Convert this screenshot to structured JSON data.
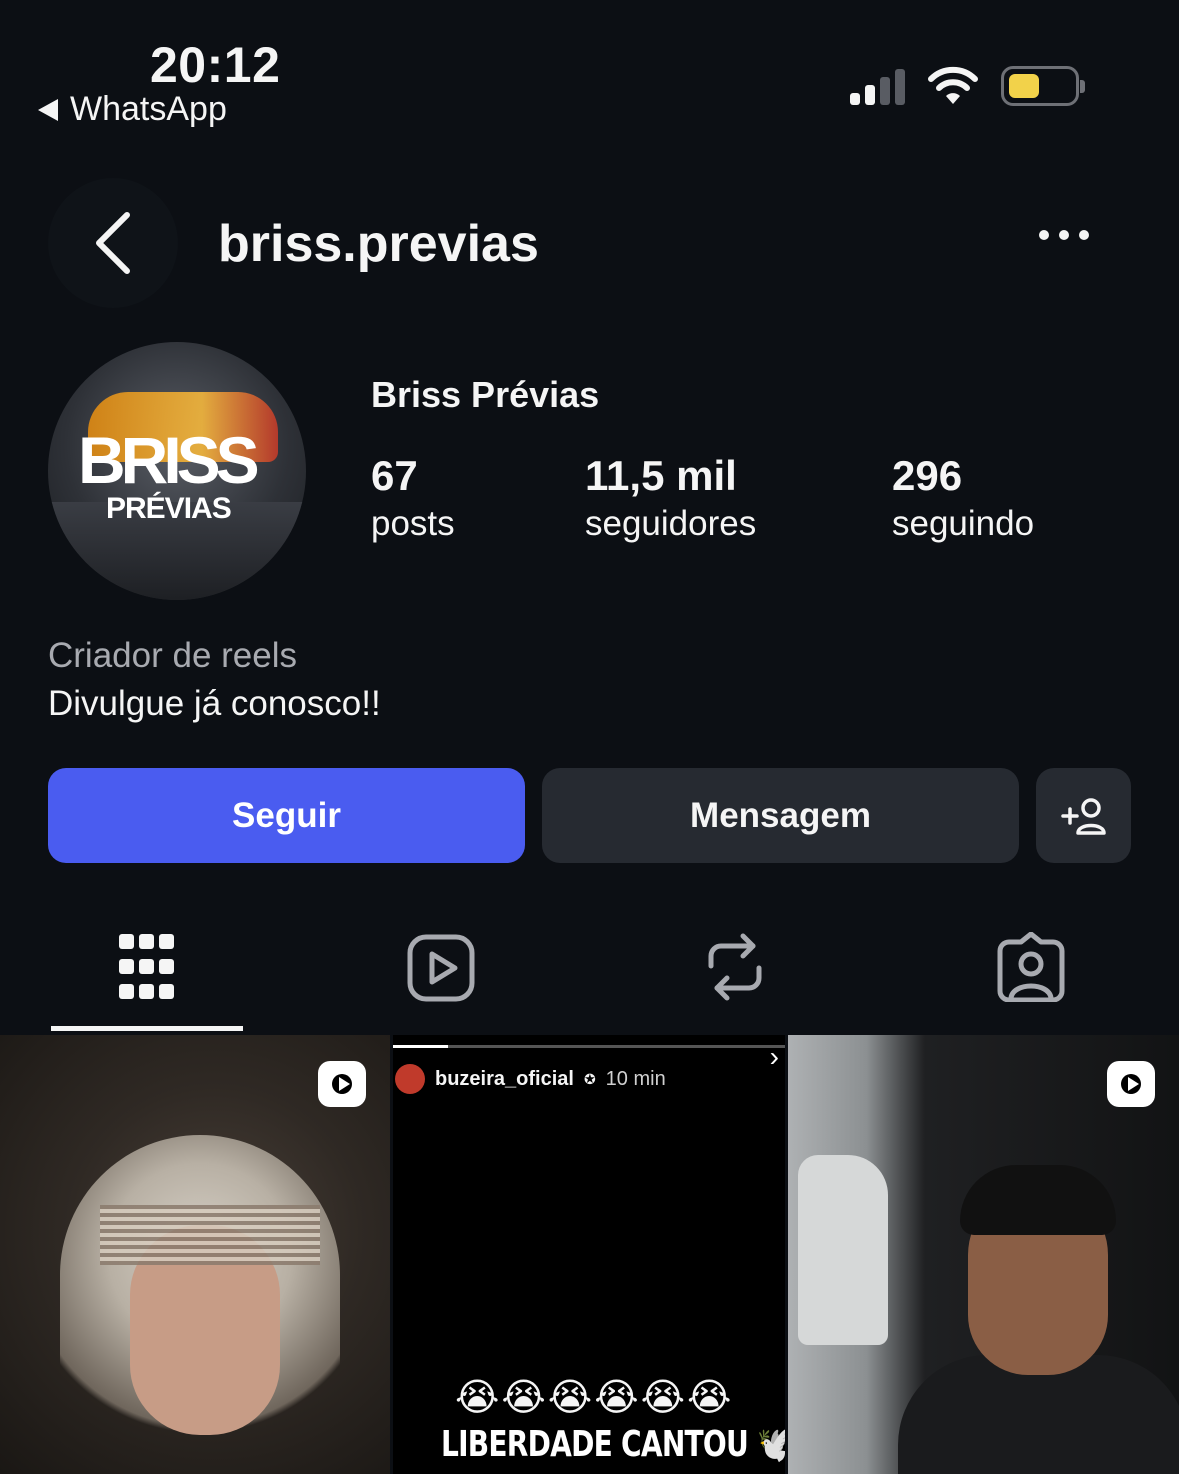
{
  "status_bar": {
    "time": "20:12",
    "back_app": "WhatsApp"
  },
  "header": {
    "username": "briss.previas"
  },
  "profile": {
    "avatar_text_main": "BRISS",
    "avatar_text_sub": "PRÉVIAS",
    "display_name": "Briss Prévias",
    "stats": [
      {
        "value": "67",
        "label": "posts"
      },
      {
        "value": "11,5 mil",
        "label": "seguidores"
      },
      {
        "value": "296",
        "label": "seguindo"
      }
    ],
    "category": "Criador de reels",
    "bio": "Divulgue já conosco!!"
  },
  "actions": {
    "follow": "Seguir",
    "message": "Mensagem"
  },
  "tabs": [
    {
      "icon": "grid-icon",
      "active": true
    },
    {
      "icon": "reels-icon",
      "active": false
    },
    {
      "icon": "repost-icon",
      "active": false
    },
    {
      "icon": "tagged-icon",
      "active": false
    }
  ],
  "grid": {
    "post2": {
      "story_user": "buzeira_oficial",
      "story_time": "10 min",
      "emojis": "😭😭😭😭😭😭",
      "caption": "LIBERDADE CANTOU"
    }
  },
  "colors": {
    "background": "#0c0f14",
    "follow_button": "#4a5cf0",
    "secondary_button": "#262a31",
    "battery": "#f2d24a"
  }
}
